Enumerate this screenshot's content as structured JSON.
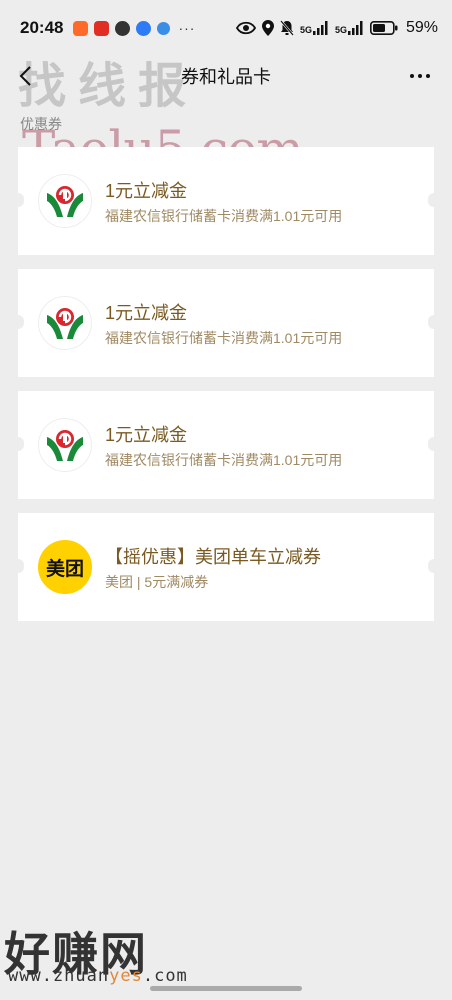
{
  "status_bar": {
    "time": "20:48",
    "app_icons": [
      {
        "name": "taobao-icon",
        "color": "#ff6a2a"
      },
      {
        "name": "pinduoduo-icon",
        "color": "#e02e24"
      },
      {
        "name": "app-icon",
        "color": "#333333"
      },
      {
        "name": "chat-icon",
        "color": "#2d7cf6"
      },
      {
        "name": "browser-icon",
        "color": "#3a8ee6"
      }
    ],
    "more_dots": "···",
    "network_1": "5G",
    "network_2": "5G",
    "battery": "59%"
  },
  "nav": {
    "title": "券和礼品卡"
  },
  "watermarks": {
    "top": "找线报",
    "site": "Taolu5.com",
    "bottom": "好赚网",
    "bottom_url_pre": "www.zhuan",
    "bottom_url_hl": "yes",
    "bottom_url_post": ".com"
  },
  "section": {
    "label": "优惠券"
  },
  "coupons": [
    {
      "title": "1元立减金",
      "desc": "福建农信银行储蓄卡消费满1.01元可用",
      "logo": "fujian-rural-credit-logo"
    },
    {
      "title": "1元立减金",
      "desc": "福建农信银行储蓄卡消费满1.01元可用",
      "logo": "fujian-rural-credit-logo"
    },
    {
      "title": "1元立减金",
      "desc": "福建农信银行储蓄卡消费满1.01元可用",
      "logo": "fujian-rural-credit-logo"
    },
    {
      "title": "【摇优惠】美团单车立减券",
      "desc": "美团 | 5元满减券",
      "logo": "meituan-logo",
      "logo_text": "美团"
    }
  ],
  "colors": {
    "background": "#ededed",
    "coupon_title": "#7a5a22",
    "coupon_desc": "#a08a64",
    "meituan_yellow": "#ffd100",
    "bank_green": "#1a8a3a",
    "bank_red": "#d8272f"
  }
}
